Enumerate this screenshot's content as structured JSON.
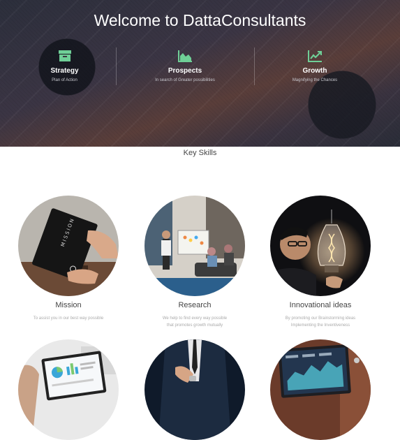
{
  "hero": {
    "title": "Welcome to DattaConsultants",
    "features": [
      {
        "icon": "archive-icon",
        "title": "Strategy",
        "subtitle": "Plan of Action"
      },
      {
        "icon": "area-chart-icon",
        "title": "Prospects",
        "subtitle": "In search of Greater possibilities"
      },
      {
        "icon": "line-chart-icon",
        "title": "Growth",
        "subtitle": "Magnifying the Chances"
      }
    ],
    "accent_color": "#6fcf97"
  },
  "skills": {
    "heading": "Key Skills",
    "cards": [
      {
        "title": "Mission",
        "desc_line1": "To assist you in our best way possible",
        "desc_line2": ""
      },
      {
        "title": "Research",
        "desc_line1": "We help to find every way possible",
        "desc_line2": "that promotes growth mutually"
      },
      {
        "title": "Innovational ideas",
        "desc_line1": "By promoting our Brainstorming ideas",
        "desc_line2": "Implementing the Inventiveness"
      }
    ]
  }
}
